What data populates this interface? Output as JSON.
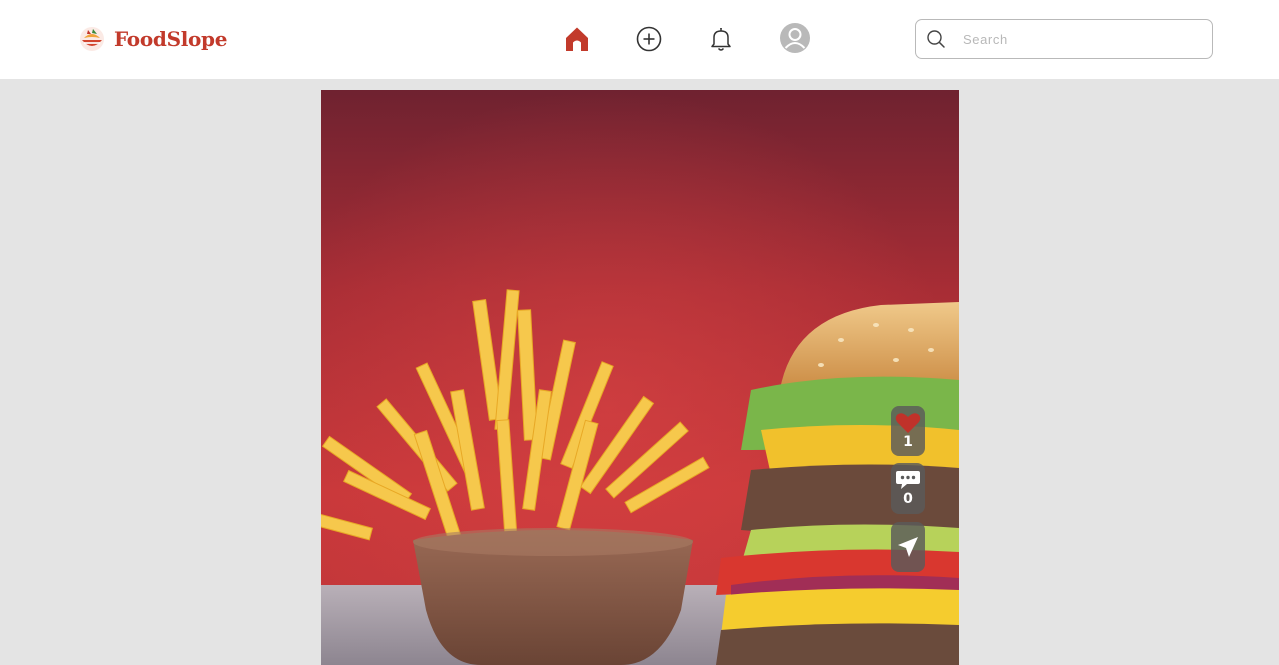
{
  "brand": {
    "name": "FoodSlope",
    "logo_icon": "foodslope-logo-icon",
    "color": "#c23a2b"
  },
  "nav": {
    "items": [
      {
        "id": "home",
        "icon": "home-icon",
        "active": true
      },
      {
        "id": "create",
        "icon": "plus-circle-icon",
        "active": false
      },
      {
        "id": "notifications",
        "icon": "bell-icon",
        "active": false
      },
      {
        "id": "profile",
        "icon": "avatar-icon",
        "active": false
      }
    ],
    "active_color": "#c23a2b"
  },
  "search": {
    "placeholder": "Search",
    "value": ""
  },
  "post": {
    "image_subject": "burger-and-fries-photo",
    "actions": {
      "likes": "1",
      "comments": "0",
      "like_icon": "heart-icon",
      "comment_icon": "speech-bubble-icon",
      "share_icon": "send-arrow-icon"
    }
  },
  "colors": {
    "header_bg": "#ffffff",
    "page_bg": "#e4e4e4",
    "like_red": "#c0322a"
  }
}
